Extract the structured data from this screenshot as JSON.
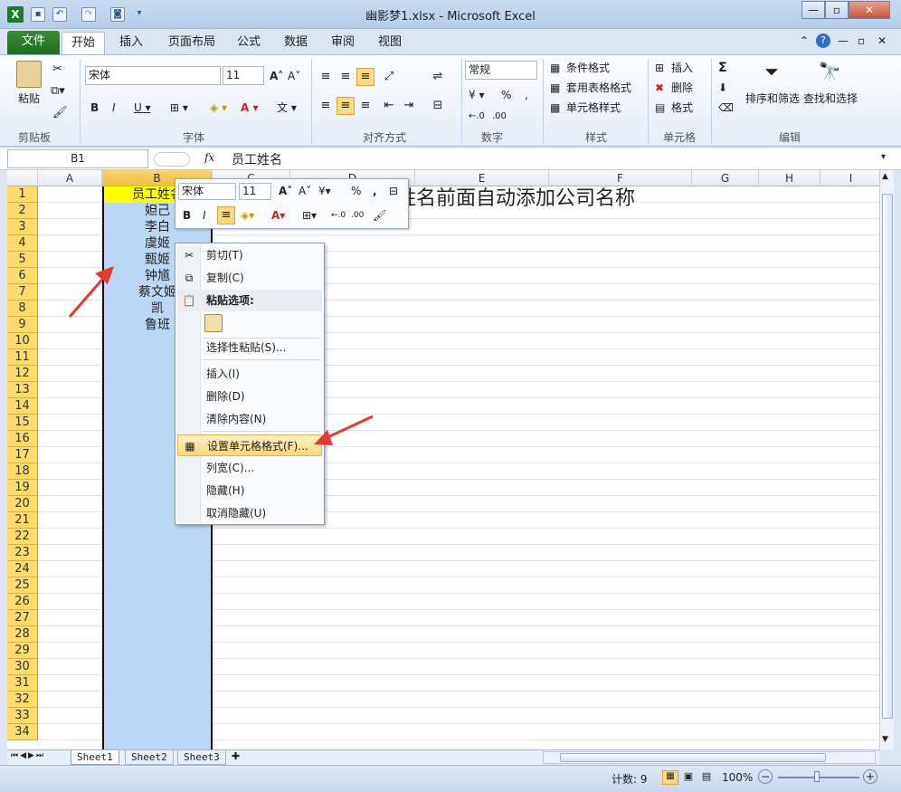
{
  "window": {
    "title": "幽影梦1.xlsx  -  Microsoft Excel"
  },
  "ribbon_tabs": [
    "文件",
    "开始",
    "插入",
    "页面布局",
    "公式",
    "数据",
    "审阅",
    "视图"
  ],
  "groups": {
    "clipboard": {
      "label": "剪贴板",
      "paste": "粘贴"
    },
    "font": {
      "label": "字体",
      "name": "宋体",
      "size": "11"
    },
    "alignment": {
      "label": "对齐方式"
    },
    "number": {
      "label": "数字",
      "format": "常规",
      "percent": "%",
      "comma": ","
    },
    "styles": {
      "label": "样式",
      "conditional": "条件格式",
      "table": "套用表格格式",
      "cell": "单元格样式"
    },
    "cells": {
      "label": "单元格",
      "insert": "插入",
      "delete": "删除",
      "format": "格式"
    },
    "editing": {
      "label": "编辑",
      "sum": "Σ",
      "sort": "排序和筛选",
      "find": "查找和选择"
    }
  },
  "formula_bar": {
    "name_box": "B1",
    "fx": "fx",
    "content": "员工姓名"
  },
  "columns": [
    "A",
    "B",
    "C",
    "D",
    "E",
    "F",
    "G",
    "H",
    "I"
  ],
  "rows": [
    "1",
    "2",
    "3",
    "4",
    "5",
    "6",
    "7",
    "8",
    "9",
    "10",
    "11",
    "12",
    "13",
    "14",
    "15",
    "16",
    "17",
    "18",
    "19",
    "20",
    "21",
    "22",
    "23",
    "24",
    "25",
    "26",
    "27",
    "28",
    "29",
    "30",
    "31",
    "32",
    "33",
    "34"
  ],
  "cells_B": [
    "员工姓名",
    "妲己",
    "李白",
    "虞姬",
    "甄姬",
    "钟馗",
    "蔡文姬",
    "凯",
    "鲁班"
  ],
  "note_text": "姓名前面自动添加公司名称",
  "mini_toolbar": {
    "font": "宋体",
    "size": "11",
    "percent": "%",
    "comma": ","
  },
  "context_menu": [
    {
      "label": "剪切(T)",
      "icon": "scissors-icon"
    },
    {
      "label": "复制(C)",
      "icon": "copy-icon"
    },
    {
      "label": "粘贴选项:",
      "icon": "clipboard-icon",
      "header": true
    },
    {
      "label": "选择性粘贴(S)...",
      "icon": ""
    },
    {
      "label": "插入(I)",
      "icon": ""
    },
    {
      "label": "删除(D)",
      "icon": ""
    },
    {
      "label": "清除内容(N)",
      "icon": ""
    },
    {
      "label": "设置单元格格式(F)...",
      "icon": "format-cells-icon",
      "highlighted": true
    },
    {
      "label": "列宽(C)...",
      "icon": ""
    },
    {
      "label": "隐藏(H)",
      "icon": ""
    },
    {
      "label": "取消隐藏(U)",
      "icon": ""
    }
  ],
  "sheet_tabs": [
    "Sheet1",
    "Sheet2",
    "Sheet3"
  ],
  "status": {
    "count": "计数: 9",
    "zoom": "100%"
  },
  "colors": {
    "accent_green": "#1f6e1f",
    "selection": "#bcd7f3",
    "row_header": "#ffdb6b",
    "highlight": "#fbd97f",
    "arrow": "#e63a2e"
  }
}
